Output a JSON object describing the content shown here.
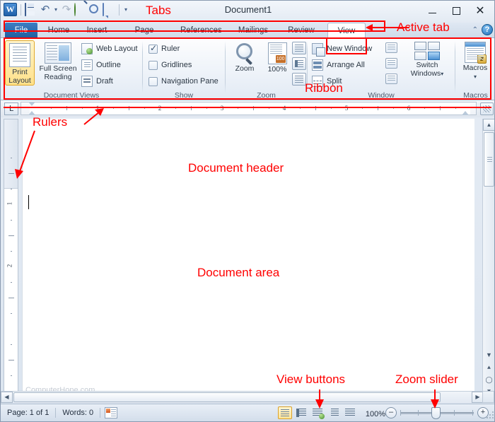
{
  "window": {
    "app_icon": "W",
    "title": "Document1",
    "minimize": "–",
    "maximize": "□",
    "close": "✕"
  },
  "quick_access": {
    "items": [
      {
        "name": "save-icon",
        "label": "Save"
      },
      {
        "name": "undo-icon",
        "label": "Undo"
      },
      {
        "name": "redo-icon",
        "label": "Redo"
      },
      {
        "name": "green-circle-icon",
        "label": "Repeat"
      },
      {
        "name": "print-preview-icon",
        "label": "Print Preview and Print"
      },
      {
        "name": "comment-icon",
        "label": "New Comment"
      }
    ],
    "dropdown": "▾"
  },
  "tabs": {
    "items": [
      {
        "label": "File",
        "active": false,
        "style": "file"
      },
      {
        "label": "Home",
        "active": false
      },
      {
        "label": "Insert",
        "active": false
      },
      {
        "label": "Page Layout",
        "active": false
      },
      {
        "label": "References",
        "active": false
      },
      {
        "label": "Mailings",
        "active": false
      },
      {
        "label": "Review",
        "active": false
      },
      {
        "label": "View",
        "active": true
      }
    ],
    "collapse_ribbon": "⌃",
    "help": "?"
  },
  "ribbon": {
    "groups": [
      {
        "name": "Document Views",
        "label": "Document Views",
        "big_buttons": [
          {
            "label_line1": "Print",
            "label_line2": "Layout",
            "icon": "print-layout-icon",
            "selected": true
          },
          {
            "label_line1": "Full Screen",
            "label_line2": "Reading",
            "icon": "full-screen-reading-icon",
            "selected": false
          }
        ],
        "small_items": [
          {
            "label": "Web Layout",
            "icon": "web-layout-icon"
          },
          {
            "label": "Outline",
            "icon": "outline-icon"
          },
          {
            "label": "Draft",
            "icon": "draft-icon"
          }
        ]
      },
      {
        "name": "Show",
        "label": "Show",
        "checkboxes": [
          {
            "label": "Ruler",
            "checked": true
          },
          {
            "label": "Gridlines",
            "checked": false
          },
          {
            "label": "Navigation Pane",
            "checked": false
          }
        ]
      },
      {
        "name": "Zoom",
        "label": "Zoom",
        "big_buttons": [
          {
            "label_line1": "Zoom",
            "label_line2": "",
            "icon": "zoom-magnifier-icon"
          },
          {
            "label_line1": "100%",
            "label_line2": "",
            "icon": "zoom-100-icon"
          }
        ],
        "mini_buttons": [
          {
            "name": "one-page-button"
          },
          {
            "name": "two-pages-button"
          },
          {
            "name": "page-width-button"
          }
        ]
      },
      {
        "name": "Window",
        "label": "Window",
        "small_items": [
          {
            "label": "New Window",
            "icon": "new-window-icon"
          },
          {
            "label": "Arrange All",
            "icon": "arrange-all-icon"
          },
          {
            "label": "Split",
            "icon": "split-icon"
          }
        ],
        "tiny_buttons": [
          {
            "name": "view-side-by-side-button"
          },
          {
            "name": "synchronous-scrolling-button"
          },
          {
            "name": "reset-window-position-button"
          }
        ],
        "big_buttons": [
          {
            "label_line1": "Switch",
            "label_line2": "Windows",
            "icon": "switch-windows-icon",
            "dropdown": "▾"
          }
        ]
      },
      {
        "name": "Macros",
        "label": "Macros",
        "big_buttons": [
          {
            "label_line1": "Macros",
            "label_line2": "",
            "icon": "macros-icon",
            "dropdown": "▾"
          }
        ]
      }
    ]
  },
  "ruler": {
    "tab_selector": "L",
    "horizontal_numbers": [
      "1",
      "2",
      "3",
      "4",
      "5",
      "6"
    ],
    "vertical_numbers": [
      "1",
      "2"
    ],
    "view_ruler_button": "view-ruler-button"
  },
  "document": {
    "header_label": "Document header",
    "area_label": "Document area",
    "watermark": "ComputerHope.com"
  },
  "status_bar": {
    "page": "Page: 1 of 1",
    "words": "Words: 0",
    "proofing_icon": "proofing-errors-icon",
    "view_buttons": [
      {
        "name": "print-layout-view-button",
        "selected": true
      },
      {
        "name": "full-screen-reading-view-button",
        "selected": false
      },
      {
        "name": "web-layout-view-button",
        "selected": false
      },
      {
        "name": "outline-view-button",
        "selected": false
      },
      {
        "name": "draft-view-button",
        "selected": false
      }
    ],
    "zoom_percent": "100%",
    "zoom_out": "–",
    "zoom_in": "+"
  },
  "annotations": [
    {
      "id": "tabs",
      "text": "Tabs"
    },
    {
      "id": "active_tab",
      "text": "Active tab"
    },
    {
      "id": "ribbon",
      "text": "Ribbon"
    },
    {
      "id": "rulers",
      "text": "Rulers"
    },
    {
      "id": "view_buttons",
      "text": "View buttons"
    },
    {
      "id": "zoom_slider",
      "text": "Zoom slider"
    }
  ],
  "colors": {
    "annotation": "#ff0000",
    "file_tab": "#1f5e9e",
    "selected_highlight": "#ffe18a"
  }
}
